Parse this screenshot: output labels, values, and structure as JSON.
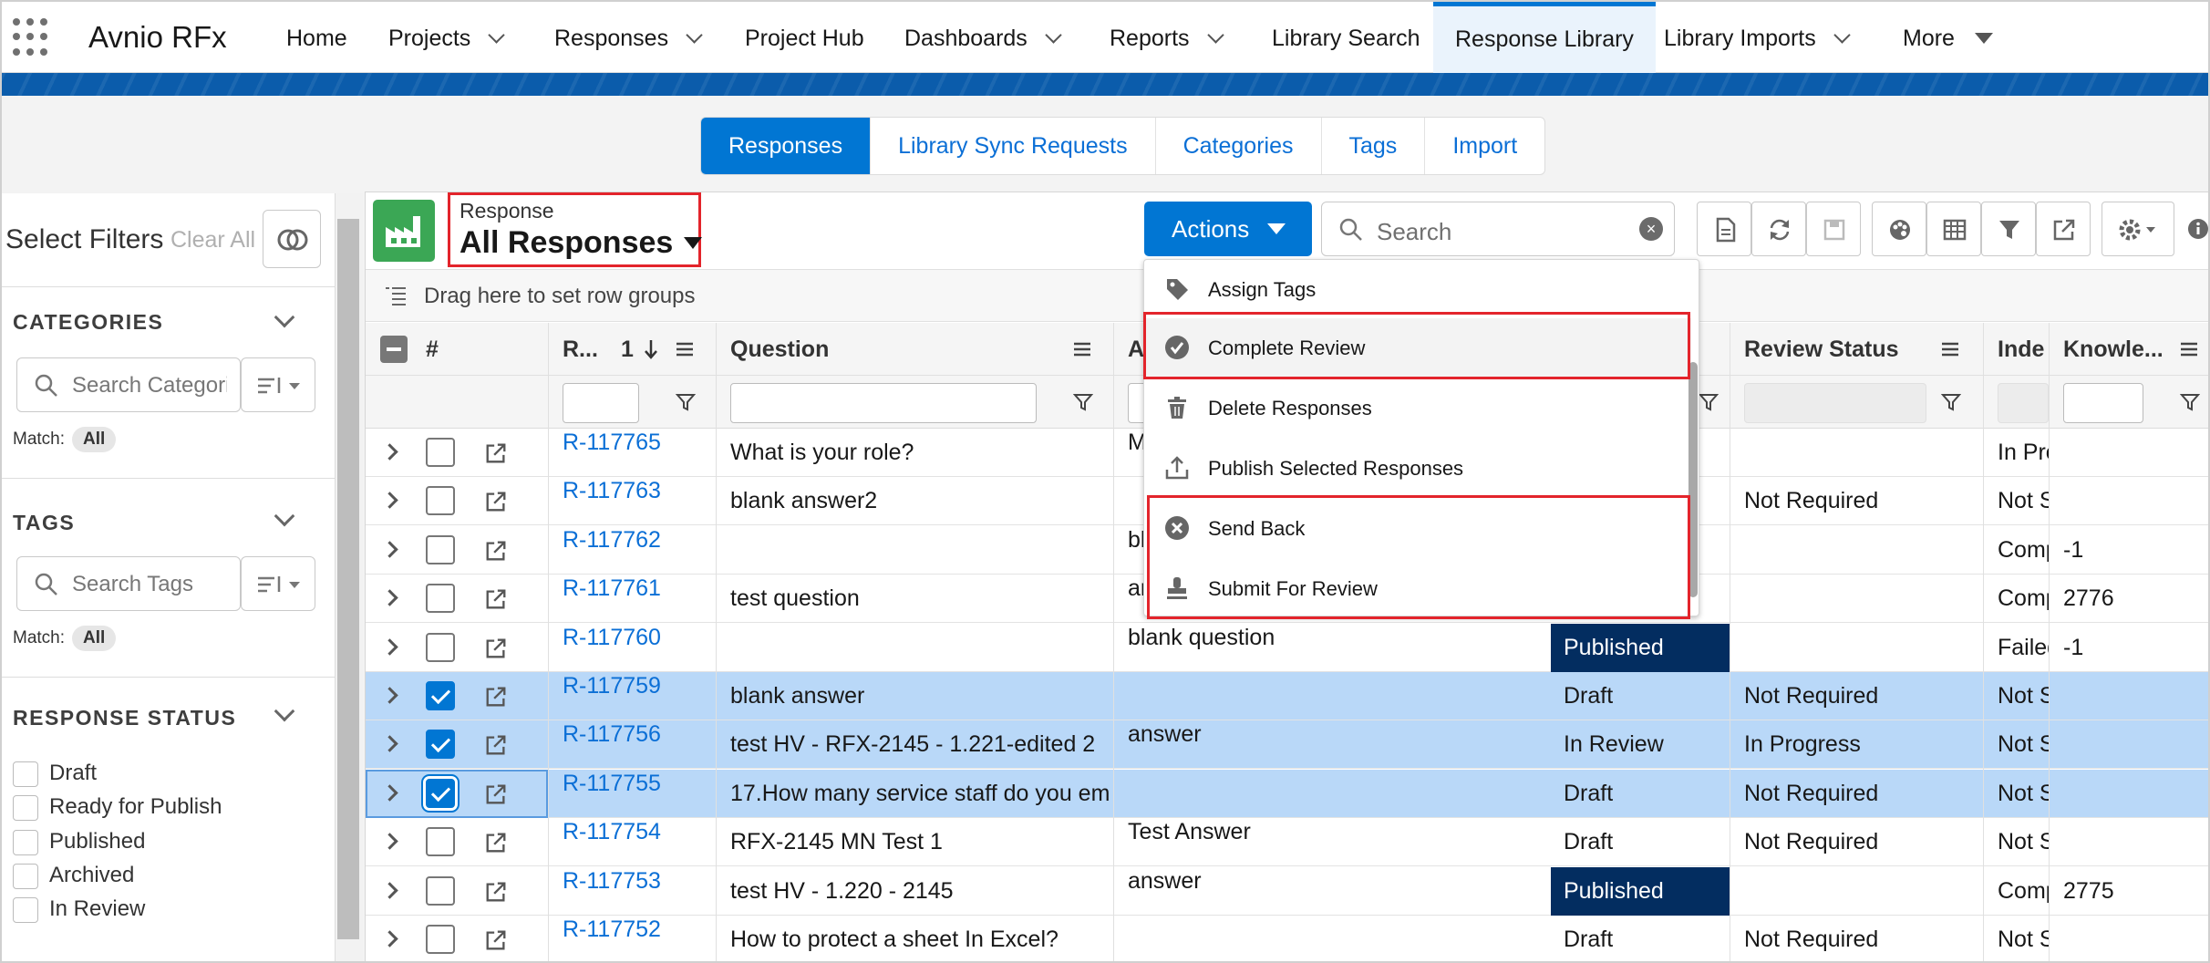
{
  "app": {
    "name": "Avnio RFx"
  },
  "nav": [
    {
      "label": "Home"
    },
    {
      "label": "Projects"
    },
    {
      "label": "Responses"
    },
    {
      "label": "Project Hub"
    },
    {
      "label": "Dashboards"
    },
    {
      "label": "Reports"
    },
    {
      "label": "Library Search"
    },
    {
      "label": "Response Library",
      "active": true
    },
    {
      "label": "Library Imports"
    },
    {
      "label": "More"
    }
  ],
  "subtabs": [
    {
      "label": "Responses",
      "active": true
    },
    {
      "label": "Library Sync Requests"
    },
    {
      "label": "Categories"
    },
    {
      "label": "Tags"
    },
    {
      "label": "Import"
    }
  ],
  "filters": {
    "title": "Select Filters",
    "clear_all": "Clear All",
    "categories": {
      "heading": "CATEGORIES",
      "placeholder": "Search Categories",
      "match_label": "Match:",
      "match_value": "All"
    },
    "tags": {
      "heading": "TAGS",
      "placeholder": "Search Tags",
      "match_label": "Match:",
      "match_value": "All"
    },
    "status": {
      "heading": "RESPONSE STATUS",
      "options": [
        "Draft",
        "Ready for Publish",
        "Published",
        "Archived",
        "In Review"
      ]
    }
  },
  "view": {
    "label": "Response",
    "value": "All Responses"
  },
  "toolbar": {
    "actions_label": "Actions",
    "search_placeholder": "Search"
  },
  "rowgroup_hint": "Drag here to set row groups",
  "columns": {
    "num": "#",
    "id": "R...",
    "sort_index": "1",
    "question": "Question",
    "answer": "A",
    "review_status": "Review Status",
    "index": "Inde",
    "knowledge": "Knowle..."
  },
  "rows": [
    {
      "id": "R-117765",
      "question": "What is your role?",
      "answer": "M",
      "status": "",
      "review": "",
      "index": "In Pro",
      "knowledge": "",
      "checked": false
    },
    {
      "id": "R-117763",
      "question": "blank answer2",
      "answer": "",
      "status": "",
      "review": "Not Required",
      "index": "Not S",
      "knowledge": "",
      "checked": false
    },
    {
      "id": "R-117762",
      "question": "",
      "answer": "bl",
      "status": "",
      "review": "",
      "index": "Comp",
      "knowledge": "-1",
      "checked": false
    },
    {
      "id": "R-117761",
      "question": "test question",
      "answer": "an",
      "status": "",
      "review": "",
      "index": "Comp",
      "knowledge": "2776",
      "checked": false
    },
    {
      "id": "R-117760",
      "question": "",
      "answer": "blank question",
      "status": "Published",
      "review": "",
      "index": "Failed",
      "knowledge": "-1",
      "checked": false
    },
    {
      "id": "R-117759",
      "question": "blank answer",
      "answer": "",
      "status": "Draft",
      "review": "Not Required",
      "index": "Not S",
      "knowledge": "",
      "checked": true
    },
    {
      "id": "R-117756",
      "question": "test HV - RFX-2145 - 1.221-edited 2",
      "answer": "answer",
      "status": "In Review",
      "review": "In Progress",
      "index": "Not S",
      "knowledge": "",
      "checked": true
    },
    {
      "id": "R-117755",
      "question": "17.How many service staff do you em",
      "answer": "",
      "status": "Draft",
      "review": "Not Required",
      "index": "Not S",
      "knowledge": "",
      "checked": true,
      "focus": true
    },
    {
      "id": "R-117754",
      "question": "RFX-2145 MN Test 1",
      "answer": "Test Answer",
      "status": "Draft",
      "review": "Not Required",
      "index": "Not S",
      "knowledge": "",
      "checked": false
    },
    {
      "id": "R-117753",
      "question": "test HV - 1.220 - 2145",
      "answer": "answer",
      "status": "Published",
      "review": "",
      "index": "Comp",
      "knowledge": "2775",
      "checked": false
    },
    {
      "id": "R-117752",
      "question": "How to protect a sheet In Excel?",
      "answer": "",
      "status": "Draft",
      "review": "Not Required",
      "index": "Not S",
      "knowledge": "",
      "checked": false
    }
  ],
  "actions_menu": [
    {
      "label": "Assign Tags",
      "icon": "tag-icon"
    },
    {
      "label": "Complete Review",
      "icon": "check-circle-icon"
    },
    {
      "label": "Delete Responses",
      "icon": "trash-icon"
    },
    {
      "label": "Publish Selected Responses",
      "icon": "upload-icon"
    },
    {
      "label": "Send Back",
      "icon": "x-circle-icon"
    },
    {
      "label": "Submit For Review",
      "icon": "stamp-icon"
    }
  ],
  "colors": {
    "brand": "#0176d3",
    "published": "#032d60",
    "selected_row": "#b9d8f8",
    "highlight_box": "#e3242b",
    "icon_green": "#3ba755"
  }
}
